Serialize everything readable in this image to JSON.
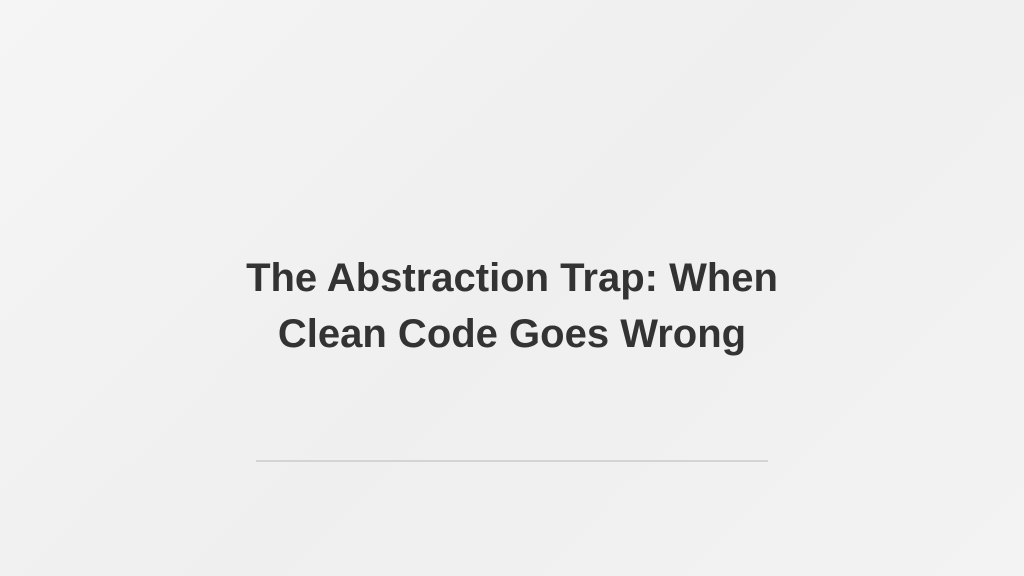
{
  "slide": {
    "title_line1": "The Abstraction Trap: When",
    "title_line2": "Clean Code Goes Wrong"
  },
  "colors": {
    "background": "#f2f2f2",
    "title_text": "#333333",
    "divider": "#d4d4d4"
  }
}
